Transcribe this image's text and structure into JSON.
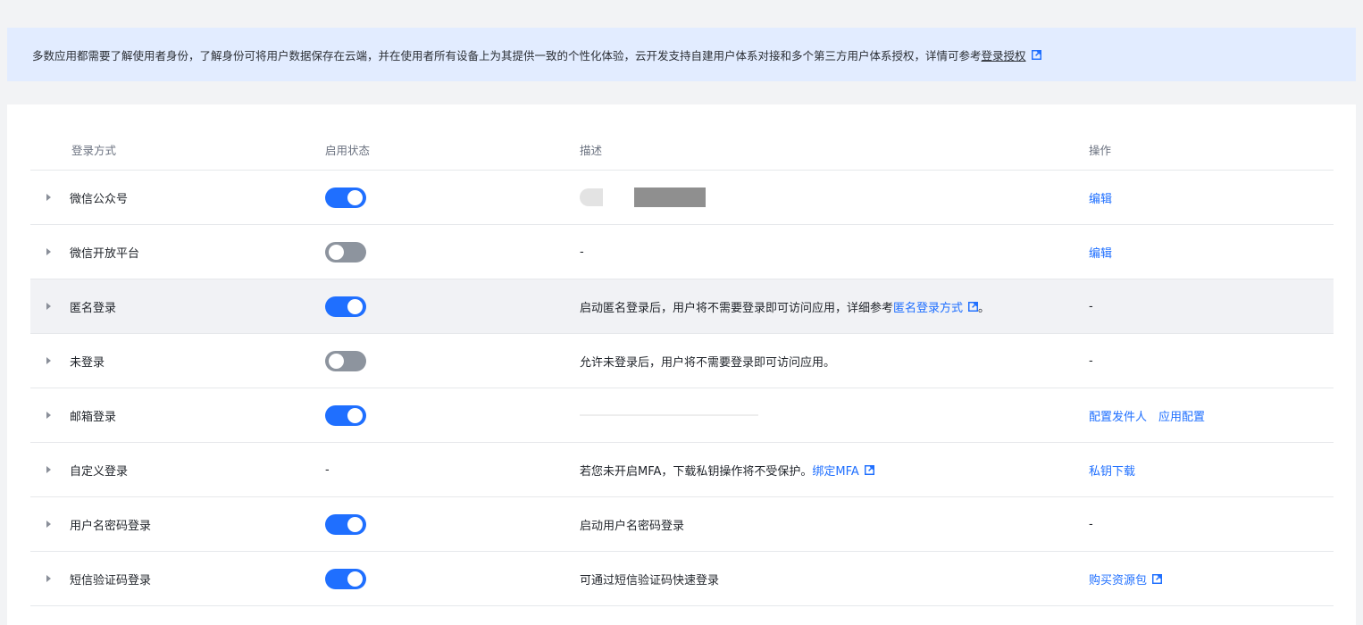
{
  "notice": {
    "text": "多数应用都需要了解使用者身份，了解身份可将用户数据保存在云端，并在使用者所有设备上为其提供一致的个性化体验，云开发支持自建用户体系对接和多个第三方用户体系授权，详情可参考",
    "link": "登录授权",
    "link_icon": "external-link-icon"
  },
  "table": {
    "headers": {
      "name": "登录方式",
      "status": "启用状态",
      "desc": "描述",
      "op": "操作"
    },
    "rows": [
      {
        "name": "微信公众号",
        "enabled": true,
        "desc": "",
        "desc_masked": true,
        "op": [
          {
            "label": "编辑"
          }
        ]
      },
      {
        "name": "微信开放平台",
        "enabled": false,
        "desc": "-",
        "op": [
          {
            "label": "编辑"
          }
        ]
      },
      {
        "name": "匿名登录",
        "enabled": true,
        "desc_prefix": "启动匿名登录后，用户将不需要登录即可访问应用，详细参考",
        "desc_link": "匿名登录方式",
        "desc_suffix": "。",
        "op_text": "-",
        "highlight": true
      },
      {
        "name": "未登录",
        "enabled": false,
        "desc": "允许未登录后，用户将不需要登录即可访问应用。",
        "op_text": "-"
      },
      {
        "name": "邮箱登录",
        "enabled": true,
        "desc": "",
        "desc_masked_light": true,
        "op": [
          {
            "label": "配置发件人"
          },
          {
            "label": "应用配置"
          }
        ]
      },
      {
        "name": "自定义登录",
        "status_text": "-",
        "desc_prefix": "若您未开启MFA，下载私钥操作将不受保护。",
        "desc_link": "绑定MFA",
        "op": [
          {
            "label": "私钥下载"
          }
        ]
      },
      {
        "name": "用户名密码登录",
        "enabled": true,
        "desc": "启动用户名密码登录",
        "op_text": "-"
      },
      {
        "name": "短信验证码登录",
        "enabled": true,
        "desc": "可通过短信验证码快速登录",
        "op": [
          {
            "label": "购买资源包",
            "external": true
          }
        ]
      }
    ]
  },
  "colors": {
    "accent": "#1f6fff",
    "switch_off": "#8d949e",
    "notice_bg": "#e2ecff",
    "row_highlight": "#f1f2f5"
  }
}
